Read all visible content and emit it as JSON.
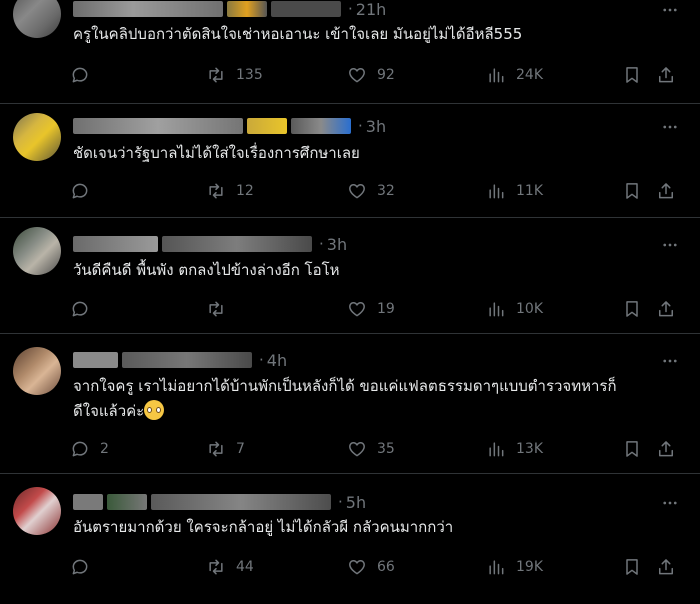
{
  "posts": [
    {
      "time": "21h",
      "text": "ครูในคลิปบอกว่าตัดสินใจเช่าหอเอานะ  เข้าใจเลย มันอยู่ไม่ได้อีหลี555",
      "replies": "",
      "reposts": "135",
      "likes": "92",
      "views": "24K"
    },
    {
      "time": "3h",
      "text": "ชัดเจนว่ารัฐบาลไม่ได้ใส่ใจเรื่องการศึกษาเลย",
      "replies": "",
      "reposts": "12",
      "likes": "32",
      "views": "11K"
    },
    {
      "time": "3h",
      "text": "วันดีคืนดี พื้นพัง ตกลงไปข้างล่างอีก โอโห",
      "replies": "",
      "reposts": "",
      "likes": "19",
      "views": "10K"
    },
    {
      "time": "4h",
      "text_line1": "จากใจครู เราไม่อยากได้บ้านพักเป็นหลังก็ได้ ขอแค่แฟลตธรรมดาๆแบบตำรวจทหารก็",
      "text_line2": "ดีใจแล้วค่ะ",
      "replies": "2",
      "reposts": "7",
      "likes": "35",
      "views": "13K"
    },
    {
      "time": "5h",
      "text": "อันตรายมากด้วย ใครจะกล้าอยู่ ไม่ได้กลัวผี กลัวคนมากกว่า",
      "replies": "",
      "reposts": "44",
      "likes": "66",
      "views": "19K"
    }
  ],
  "icons": {
    "reply": "reply-icon",
    "repost": "repost-icon",
    "like": "heart-icon",
    "views": "views-chart-icon",
    "bookmark": "bookmark-icon",
    "share": "share-icon",
    "more": "more-options-icon",
    "emoji": "pleading-face-emoji"
  },
  "colors": {
    "background": "#000000",
    "text": "#e7e9ea",
    "muted": "#71767b",
    "divider": "#2f3336"
  }
}
